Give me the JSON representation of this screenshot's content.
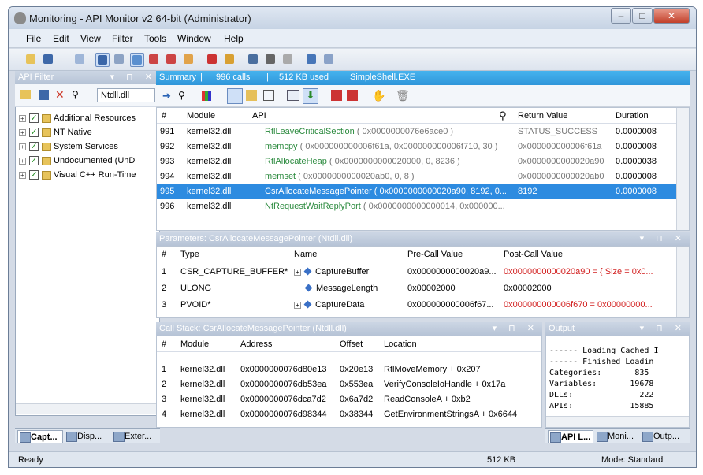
{
  "window": {
    "title": "Monitoring - API Monitor v2 64-bit (Administrator)"
  },
  "menu": [
    "File",
    "Edit",
    "View",
    "Filter",
    "Tools",
    "Window",
    "Help"
  ],
  "api_filter": {
    "title": "API Filter",
    "module_field": "Ntdll.dll",
    "items": [
      "Additional Resources",
      "NT Native",
      "System Services",
      "Undocumented (UnD",
      "Visual C++ Run-Time"
    ]
  },
  "summary": {
    "label": "Summary",
    "calls": "996 calls",
    "memory": "512 KB used",
    "process": "SimpleShell.EXE"
  },
  "calls_grid": {
    "headers": [
      "#",
      "Module",
      "API",
      "Return Value",
      "Duration"
    ],
    "rows": [
      {
        "n": "991",
        "module": "kernel32.dll",
        "api": "RtlLeaveCriticalSection",
        "args": " ( 0x0000000076e6ace0 )",
        "ret": "STATUS_SUCCESS",
        "dur": "0.0000008"
      },
      {
        "n": "992",
        "module": "kernel32.dll",
        "api": "memcpy",
        "args": " ( 0x000000000006f61a, 0x000000000006f710, 30 )",
        "ret": "0x000000000006f61a",
        "dur": "0.0000008"
      },
      {
        "n": "993",
        "module": "kernel32.dll",
        "api": "RtlAllocateHeap",
        "args": " ( 0x0000000000020000, 0, 8236 )",
        "ret": "0x0000000000020a90",
        "dur": "0.0000038"
      },
      {
        "n": "994",
        "module": "kernel32.dll",
        "api": "memset",
        "args": " ( 0x0000000000020ab0, 0, 8 )",
        "ret": "0x0000000000020ab0",
        "dur": "0.0000008"
      },
      {
        "n": "995",
        "module": "kernel32.dll",
        "api": "CsrAllocateMessagePointer",
        "args": " ( 0x0000000000020a90, 8192, 0...",
        "ret": "8192",
        "dur": "0.0000008"
      },
      {
        "n": "996",
        "module": "kernel32.dll",
        "api": "NtRequestWaitReplyPort",
        "args": " ( 0x0000000000000014, 0x000000...",
        "ret": "",
        "dur": ""
      }
    ]
  },
  "params": {
    "title": "Parameters: CsrAllocateMessagePointer (Ntdll.dll)",
    "headers": [
      "#",
      "Type",
      "Name",
      "Pre-Call Value",
      "Post-Call Value"
    ],
    "rows": [
      {
        "n": "1",
        "type": "CSR_CAPTURE_BUFFER*",
        "name": "CaptureBuffer",
        "pre": "0x0000000000020a9...",
        "post": "0x0000000000020a90 = { Size = 0x0..."
      },
      {
        "n": "2",
        "type": "ULONG",
        "name": "MessageLength",
        "pre": "0x00002000",
        "post": "0x00002000"
      },
      {
        "n": "3",
        "type": "PVOID*",
        "name": "CaptureData",
        "pre": "0x000000000006f67...",
        "post": "0x000000000006f670 = 0x00000000..."
      }
    ]
  },
  "callstack": {
    "title": "Call Stack: CsrAllocateMessagePointer (Ntdll.dll)",
    "headers": [
      "#",
      "Module",
      "Address",
      "Offset",
      "Location"
    ],
    "rows": [
      {
        "n": "1",
        "module": "kernel32.dll",
        "addr": "0x0000000076d80e13",
        "off": "0x20e13",
        "loc": "RtlMoveMemory + 0x207"
      },
      {
        "n": "2",
        "module": "kernel32.dll",
        "addr": "0x0000000076db53ea",
        "off": "0x553ea",
        "loc": "VerifyConsoleIoHandle + 0x17a"
      },
      {
        "n": "3",
        "module": "kernel32.dll",
        "addr": "0x0000000076dca7d2",
        "off": "0x6a7d2",
        "loc": "ReadConsoleA + 0xb2"
      },
      {
        "n": "4",
        "module": "kernel32.dll",
        "addr": "0x0000000076d98344",
        "off": "0x38344",
        "loc": "GetEnvironmentStringsA + 0x6644"
      }
    ]
  },
  "output": {
    "title": "Output",
    "lines": [
      "------ Loading Cached I",
      "------ Finished Loadin",
      "Categories:       835",
      "Variables:       19678",
      "DLLs:              222",
      "APIs:            15885"
    ]
  },
  "left_tabs": [
    "Capt...",
    "Disp...",
    "Exter..."
  ],
  "right_tabs": [
    "API L...",
    "Moni...",
    "Outp..."
  ],
  "status": {
    "left": "Ready",
    "mem": "512 KB",
    "mode": "Mode: Standard"
  }
}
